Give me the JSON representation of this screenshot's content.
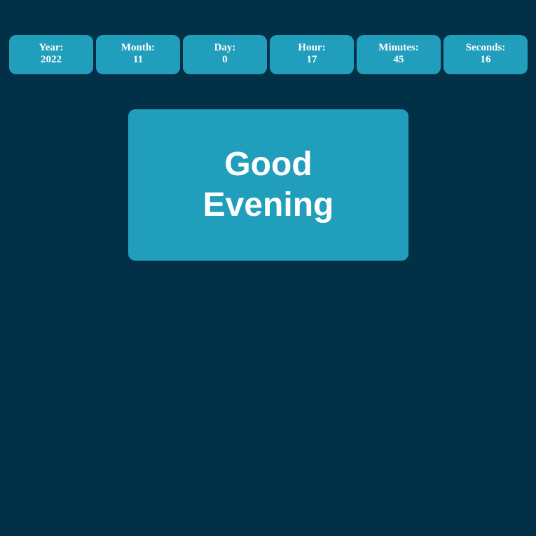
{
  "colors": {
    "background": "#023047",
    "card": "#219ebc",
    "text": "#ffffff"
  },
  "time": {
    "year": {
      "label": "Year:",
      "value": "2022"
    },
    "month": {
      "label": "Month:",
      "value": "11"
    },
    "day": {
      "label": "Day:",
      "value": "0"
    },
    "hour": {
      "label": "Hour:",
      "value": "17"
    },
    "minutes": {
      "label": "Minutes:",
      "value": "45"
    },
    "seconds": {
      "label": "Seconds:",
      "value": "16"
    }
  },
  "greeting": {
    "text": "Good Evening"
  }
}
